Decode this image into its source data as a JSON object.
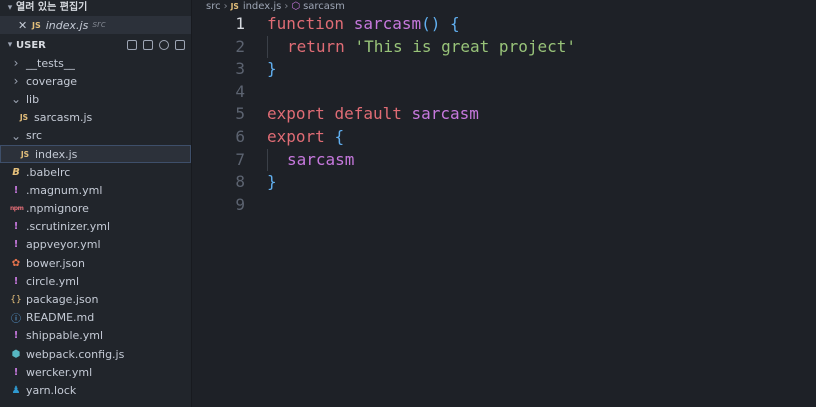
{
  "open_editors": {
    "title": "열려 있는 편집기",
    "items": [
      {
        "filename": "index.js",
        "dir": "src",
        "badge": "JS"
      }
    ]
  },
  "explorer": {
    "title": "USER",
    "tree": [
      {
        "name": "__tests__",
        "type": "folder",
        "expanded": false,
        "icon": "chevron-right-icon",
        "indent": 1
      },
      {
        "name": "coverage",
        "type": "folder",
        "expanded": false,
        "icon": "chevron-right-icon",
        "indent": 1
      },
      {
        "name": "lib",
        "type": "folder",
        "expanded": true,
        "icon": "chevron-down-icon",
        "indent": 1
      },
      {
        "name": "sarcasm.js",
        "type": "file",
        "icon": "js-file-icon",
        "badge": "JS",
        "indent": 2
      },
      {
        "name": "src",
        "type": "folder",
        "expanded": true,
        "icon": "chevron-down-icon",
        "indent": 1
      },
      {
        "name": "index.js",
        "type": "file",
        "icon": "js-file-icon",
        "badge": "JS",
        "indent": 2,
        "selected": true
      },
      {
        "name": ".babelrc",
        "type": "file",
        "icon": "babel-icon",
        "badge": "B",
        "indent": 1
      },
      {
        "name": ".magnum.yml",
        "type": "file",
        "icon": "yml-icon",
        "badge": "!",
        "indent": 1
      },
      {
        "name": ".npmignore",
        "type": "file",
        "icon": "npm-icon",
        "badge": "npm",
        "indent": 1
      },
      {
        "name": ".scrutinizer.yml",
        "type": "file",
        "icon": "yml-icon",
        "badge": "!",
        "indent": 1
      },
      {
        "name": "appveyor.yml",
        "type": "file",
        "icon": "yml-icon",
        "badge": "!",
        "indent": 1
      },
      {
        "name": "bower.json",
        "type": "file",
        "icon": "bower-icon",
        "badge": "✿",
        "indent": 1
      },
      {
        "name": "circle.yml",
        "type": "file",
        "icon": "yml-icon",
        "badge": "!",
        "indent": 1
      },
      {
        "name": "package.json",
        "type": "file",
        "icon": "json-icon",
        "badge": "{}",
        "indent": 1
      },
      {
        "name": "README.md",
        "type": "file",
        "icon": "info-icon",
        "badge": "ⓘ",
        "indent": 1
      },
      {
        "name": "shippable.yml",
        "type": "file",
        "icon": "yml-icon",
        "badge": "!",
        "indent": 1
      },
      {
        "name": "webpack.config.js",
        "type": "file",
        "icon": "webpack-icon",
        "badge": "⬢",
        "indent": 1
      },
      {
        "name": "wercker.yml",
        "type": "file",
        "icon": "yml-icon",
        "badge": "!",
        "indent": 1
      },
      {
        "name": "yarn.lock",
        "type": "file",
        "icon": "yarn-icon",
        "badge": "♟",
        "indent": 1
      }
    ]
  },
  "breadcrumb": {
    "folder": "src",
    "badge": "JS",
    "file": "index.js",
    "symbol": "sarcasm"
  },
  "editor": {
    "active_line": 1,
    "lines": [
      {
        "n": "1",
        "tokens": [
          {
            "t": "function ",
            "c": "kw"
          },
          {
            "t": "sarcasm",
            "c": "fn"
          },
          {
            "t": "() ",
            "c": "pn"
          },
          {
            "t": "{",
            "c": "pn"
          }
        ]
      },
      {
        "n": "2",
        "indent": 1,
        "tokens": [
          {
            "t": "return ",
            "c": "kw"
          },
          {
            "t": "'This is great project'",
            "c": "str"
          }
        ]
      },
      {
        "n": "3",
        "tokens": [
          {
            "t": "}",
            "c": "pn"
          }
        ]
      },
      {
        "n": "4",
        "tokens": []
      },
      {
        "n": "5",
        "tokens": [
          {
            "t": "export ",
            "c": "kw"
          },
          {
            "t": "default ",
            "c": "kw"
          },
          {
            "t": "sarcasm",
            "c": "plain"
          }
        ]
      },
      {
        "n": "6",
        "tokens": [
          {
            "t": "export ",
            "c": "kw"
          },
          {
            "t": "{",
            "c": "pn"
          }
        ]
      },
      {
        "n": "7",
        "indent": 1,
        "tokens": [
          {
            "t": "sarcasm",
            "c": "plain"
          }
        ]
      },
      {
        "n": "8",
        "tokens": [
          {
            "t": "}",
            "c": "pn"
          }
        ]
      },
      {
        "n": "9",
        "tokens": []
      }
    ]
  },
  "colors": {
    "keyword": "#e06c75",
    "function": "#c678dd",
    "string": "#98c379",
    "punctuation": "#61afef",
    "background": "#1e2127",
    "sidebar": "#21252b"
  }
}
